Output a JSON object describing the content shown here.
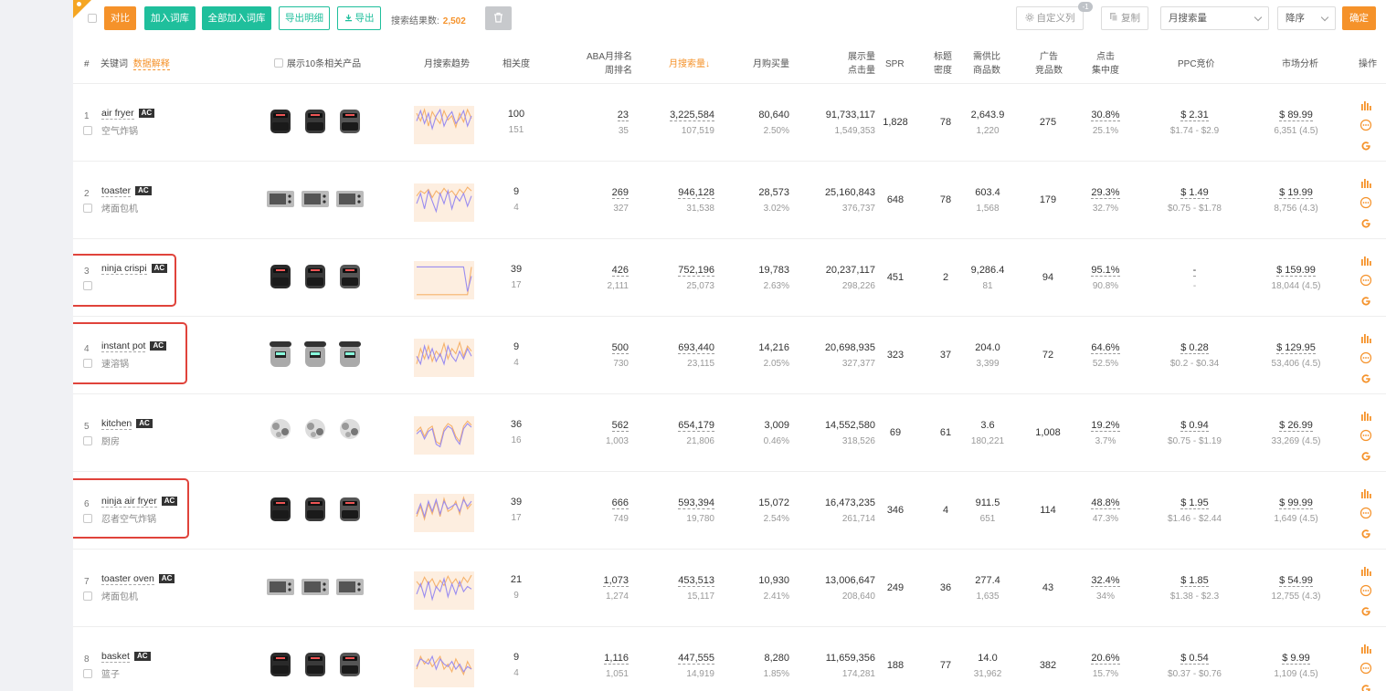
{
  "toolbar": {
    "compare_label": "对比",
    "add_to_lib_label": "加入词库",
    "add_all_to_lib_label": "全部加入词库",
    "export_detail_label": "导出明细",
    "export_label": "导出",
    "results_label": "搜索结果数:",
    "results_count": "2,502",
    "custom_columns_label": "自定义列",
    "custom_columns_badge": "-1",
    "copy_label": "复制",
    "sort_field_value": "月搜索量",
    "sort_order_value": "降序",
    "confirm_label": "确定"
  },
  "header": {
    "num": "#",
    "keyword": "关键词",
    "data_explain": "数据解释",
    "show_products": "展示10条相关产品",
    "trend": "月搜索趋势",
    "relevance": "相关度",
    "aba_rank_1": "ABA月排名",
    "aba_rank_2": "周排名",
    "monthly_search": "月搜索量↓",
    "monthly_purchase": "月购买量",
    "impressions_1": "展示量",
    "impressions_2": "点击量",
    "spr": "SPR",
    "title_density_1": "标题",
    "title_density_2": "密度",
    "supply_1": "需供比",
    "supply_2": "商品数",
    "ads_1": "广告",
    "ads_2": "竞品数",
    "click_1": "点击",
    "click_2": "集中度",
    "ppc": "PPC竞价",
    "market": "市场分析",
    "ops": "操作"
  },
  "rows": [
    {
      "num": "1",
      "kw": "air fryer",
      "ac": "AC",
      "cn": "空气炸锅",
      "rel": "100",
      "rel2": "151",
      "aba": "23",
      "week": "35",
      "search": "3,225,584",
      "search2": "107,519",
      "buy": "80,640",
      "buy2": "2.50%",
      "imp": "91,733,117",
      "clk": "1,549,353",
      "spr": "1,828",
      "td": "78",
      "sd": "2,643.9",
      "goods": "1,220",
      "ads": "275",
      "cc": "30.8%",
      "cc2": "25.1%",
      "ppc": "$ 2.31",
      "ppc2": "$1.74 - $2.9",
      "mk": "$ 89.99",
      "mk2": "6,351 (4.5)",
      "spark": {
        "a": [
          55,
          40,
          62,
          30,
          58,
          45,
          35,
          60,
          42,
          50,
          28,
          55,
          38,
          62,
          45
        ],
        "b": [
          40,
          60,
          35,
          55,
          25,
          50,
          62,
          30,
          48,
          58,
          35,
          45,
          60,
          30,
          50
        ]
      }
    },
    {
      "num": "2",
      "kw": "toaster",
      "ac": "AC",
      "cn": "烤面包机",
      "rel": "9",
      "rel2": "4",
      "aba": "269",
      "week": "327",
      "search": "946,128",
      "search2": "31,538",
      "buy": "28,573",
      "buy2": "3.02%",
      "imp": "25,160,843",
      "clk": "376,737",
      "spr": "648",
      "td": "78",
      "sd": "603.4",
      "goods": "1,568",
      "ads": "179",
      "cc": "29.3%",
      "cc2": "32.7%",
      "ppc": "$ 1.49",
      "ppc2": "$0.75 - $1.78",
      "mk": "$ 19.99",
      "mk2": "8,756 (4.3)",
      "spark": {
        "a": [
          45,
          55,
          50,
          58,
          42,
          55,
          48,
          60,
          50,
          55,
          45,
          58,
          50,
          62,
          55
        ],
        "b": [
          30,
          50,
          20,
          55,
          35,
          15,
          50,
          30,
          55,
          20,
          45,
          35,
          50,
          25,
          45
        ]
      }
    },
    {
      "num": "3",
      "kw": "ninja crispi",
      "ac": "AC",
      "cn": "",
      "rel": "39",
      "rel2": "17",
      "aba": "426",
      "week": "2,111",
      "search": "752,196",
      "search2": "25,073",
      "buy": "19,783",
      "buy2": "2.63%",
      "imp": "20,237,117",
      "clk": "298,226",
      "spr": "451",
      "td": "2",
      "sd": "9,286.4",
      "goods": "81",
      "ads": "94",
      "cc": "95.1%",
      "cc2": "90.8%",
      "ppc": "-",
      "ppc2": "-",
      "mk": "$ 159.99",
      "mk2": "18,044 (4.5)",
      "spark": {
        "a": [
          4,
          4,
          4,
          4,
          4,
          4,
          4,
          4,
          4,
          4,
          4,
          4,
          4,
          4,
          58
        ],
        "b": [
          58,
          58,
          58,
          58,
          58,
          58,
          58,
          58,
          58,
          58,
          58,
          58,
          58,
          10,
          40
        ]
      }
    },
    {
      "num": "4",
      "kw": "instant pot",
      "ac": "AC",
      "cn": "速溶锅",
      "rel": "9",
      "rel2": "4",
      "aba": "500",
      "week": "730",
      "search": "693,440",
      "search2": "23,115",
      "buy": "14,216",
      "buy2": "2.05%",
      "imp": "20,698,935",
      "clk": "327,377",
      "spr": "323",
      "td": "37",
      "sd": "204.0",
      "goods": "3,399",
      "ads": "72",
      "cc": "64.6%",
      "cc2": "52.5%",
      "ppc": "$ 0.28",
      "ppc2": "$0.2 - $0.34",
      "mk": "$ 129.95",
      "mk2": "53,406 (4.5)",
      "spark": {
        "a": [
          20,
          50,
          30,
          55,
          25,
          45,
          35,
          60,
          30,
          50,
          40,
          62,
          35,
          55,
          45
        ],
        "b": [
          35,
          20,
          55,
          30,
          50,
          25,
          40,
          20,
          55,
          35,
          25,
          45,
          30,
          50,
          35
        ]
      }
    },
    {
      "num": "5",
      "kw": "kitchen",
      "ac": "AC",
      "cn": "厨房",
      "rel": "36",
      "rel2": "16",
      "aba": "562",
      "week": "1,003",
      "search": "654,179",
      "search2": "21,806",
      "buy": "3,009",
      "buy2": "0.46%",
      "imp": "14,552,580",
      "clk": "318,526",
      "spr": "69",
      "td": "61",
      "sd": "3.6",
      "goods": "180,221",
      "ads": "1,008",
      "cc": "19.2%",
      "cc2": "3.7%",
      "ppc": "$ 0.94",
      "ppc2": "$0.75 - $1.19",
      "mk": "$ 26.99",
      "mk2": "33,269 (4.5)",
      "spark": {
        "a": [
          40,
          48,
          30,
          45,
          50,
          20,
          15,
          45,
          55,
          50,
          30,
          20,
          50,
          60,
          52
        ],
        "b": [
          35,
          42,
          25,
          40,
          45,
          15,
          10,
          40,
          50,
          45,
          25,
          15,
          45,
          55,
          48
        ]
      }
    },
    {
      "num": "6",
      "kw": "ninja air fryer",
      "ac": "AC",
      "cn": "忍者空气炸锅",
      "rel": "39",
      "rel2": "17",
      "aba": "666",
      "week": "749",
      "search": "593,394",
      "search2": "19,780",
      "buy": "15,072",
      "buy2": "2.54%",
      "imp": "16,473,235",
      "clk": "261,714",
      "spr": "346",
      "td": "4",
      "sd": "911.5",
      "goods": "651",
      "ads": "114",
      "cc": "48.8%",
      "cc2": "47.3%",
      "ppc": "$ 1.95",
      "ppc2": "$1.46 - $2.44",
      "mk": "$ 99.99",
      "mk2": "1,649 (4.5)",
      "spark": {
        "a": [
          25,
          45,
          20,
          50,
          30,
          55,
          25,
          60,
          35,
          40,
          55,
          30,
          62,
          40,
          50
        ],
        "b": [
          30,
          50,
          25,
          55,
          35,
          58,
          30,
          55,
          40,
          45,
          50,
          35,
          58,
          45,
          55
        ]
      }
    },
    {
      "num": "7",
      "kw": "toaster oven",
      "ac": "AC",
      "cn": "烤面包机",
      "rel": "21",
      "rel2": "9",
      "aba": "1,073",
      "week": "1,274",
      "search": "453,513",
      "search2": "15,117",
      "buy": "10,930",
      "buy2": "2.41%",
      "imp": "13,006,647",
      "clk": "208,640",
      "spr": "249",
      "td": "36",
      "sd": "277.4",
      "goods": "1,635",
      "ads": "43",
      "cc": "32.4%",
      "cc2": "34%",
      "ppc": "$ 1.85",
      "ppc2": "$1.38 - $2.3",
      "mk": "$ 54.99",
      "mk2": "12,755 (4.3)",
      "spark": {
        "a": [
          50,
          40,
          58,
          45,
          55,
          38,
          52,
          42,
          60,
          45,
          55,
          40,
          58,
          48,
          62
        ],
        "b": [
          25,
          45,
          20,
          50,
          15,
          40,
          30,
          55,
          20,
          45,
          25,
          50,
          30,
          40,
          35
        ]
      }
    },
    {
      "num": "8",
      "kw": "basket",
      "ac": "AC",
      "cn": "篮子",
      "rel": "9",
      "rel2": "4",
      "aba": "1,116",
      "week": "1,051",
      "search": "447,555",
      "search2": "14,919",
      "buy": "8,280",
      "buy2": "1.85%",
      "imp": "11,659,356",
      "clk": "174,281",
      "spr": "188",
      "td": "77",
      "sd": "14.0",
      "goods": "31,962",
      "ads": "382",
      "cc": "20.6%",
      "cc2": "15.7%",
      "ppc": "$ 0.54",
      "ppc2": "$0.37 - $0.76",
      "mk": "$ 9.99",
      "mk2": "1,109 (4.5)",
      "spark": {
        "a": [
          30,
          55,
          40,
          50,
          35,
          45,
          55,
          30,
          40,
          25,
          50,
          35,
          20,
          45,
          30
        ],
        "b": [
          35,
          50,
          45,
          40,
          55,
          30,
          50,
          40,
          35,
          45,
          30,
          40,
          25,
          35,
          30
        ]
      }
    }
  ],
  "icons": [
    "bar-chart-icon",
    "more-icon",
    "google-icon",
    "gear-icon",
    "copy-icon",
    "trash-icon",
    "download-icon"
  ],
  "colors": {
    "orange": "#f5922a",
    "green": "#1fbf9c",
    "spark_orange": "#f6b26b",
    "spark_purple": "#9a8cf0",
    "highlight_red": "#e0433b"
  }
}
